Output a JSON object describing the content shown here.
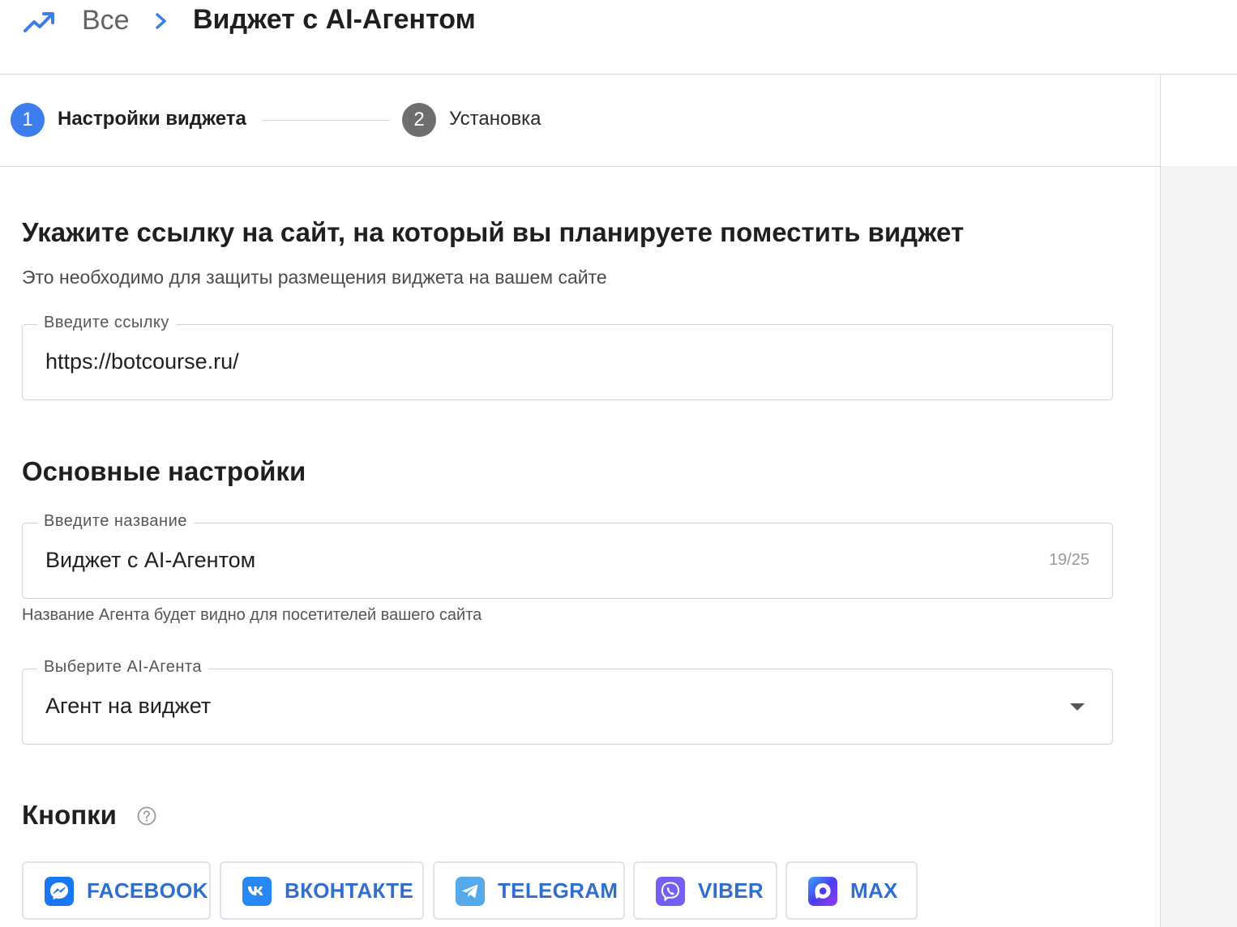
{
  "header": {
    "breadcrumb_root": "Все",
    "title": "Виджет с AI-Агентом",
    "accent_color": "#3b7ded"
  },
  "stepper": {
    "steps": [
      {
        "number": "1",
        "label": "Настройки виджета",
        "active": true
      },
      {
        "number": "2",
        "label": "Установка",
        "active": false
      }
    ]
  },
  "site_section": {
    "heading": "Укажите ссылку на сайт, на который вы планируете поместить виджет",
    "description": "Это необходимо для защиты размещения виджета на вашем сайте",
    "link_field": {
      "label": "Введите ссылку",
      "value": "https://botcourse.ru/"
    }
  },
  "main_settings": {
    "heading": "Основные настройки",
    "name_field": {
      "label": "Введите название",
      "value": "Виджет с AI-Агентом",
      "counter": "19/25"
    },
    "name_hint": "Название Агента будет видно для посетителей вашего сайта",
    "agent_select": {
      "label": "Выберите AI-Агента",
      "value": "Агент на виджет"
    }
  },
  "buttons_section": {
    "heading": "Кнопки",
    "channels": [
      {
        "label": "FACEBOOK",
        "icon": "messenger-icon",
        "color": "#1877f2"
      },
      {
        "label": "ВКОНТАКТЕ",
        "icon": "vk-icon",
        "color": "#2787f5"
      },
      {
        "label": "TELEGRAM",
        "icon": "telegram-icon",
        "color": "#54a9eb"
      },
      {
        "label": "VIBER",
        "icon": "viber-icon",
        "color": "#7360f2"
      },
      {
        "label": "MAX",
        "icon": "max-icon",
        "color": "#6a3cf0"
      }
    ]
  }
}
